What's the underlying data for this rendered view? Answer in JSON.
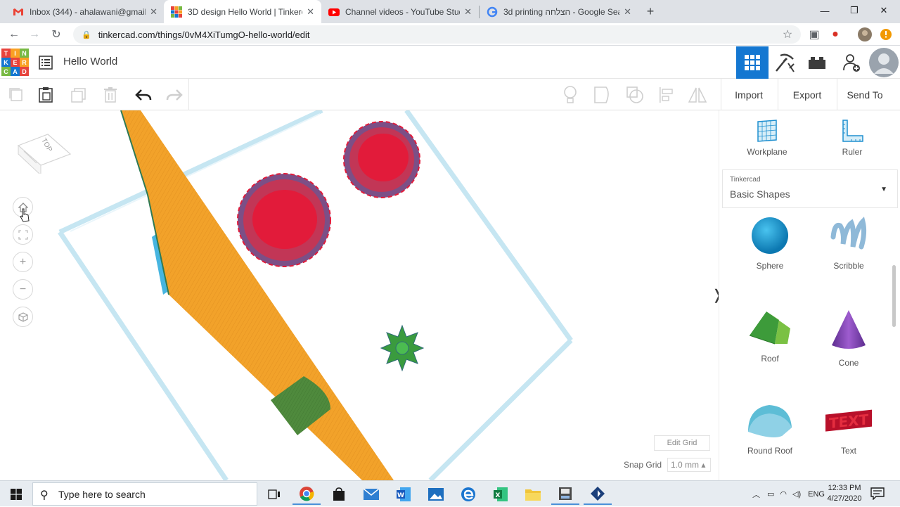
{
  "browser": {
    "tabs": [
      {
        "title": "Inbox (344) - ahalawani@gmail.c",
        "icon": "gmail-icon",
        "active": false
      },
      {
        "title": "3D design Hello World | Tinkerca",
        "icon": "tinkercad-icon",
        "active": true
      },
      {
        "title": "Channel videos - YouTube Studio",
        "icon": "youtube-icon",
        "active": false
      },
      {
        "title": "3d printing הצלחה - Google Sear",
        "icon": "google-icon",
        "active": false
      }
    ],
    "url": "tinkercad.com/things/0vM4XiTumgO-hello-world/edit"
  },
  "app": {
    "logo_letters": [
      "T",
      "I",
      "N",
      "K",
      "E",
      "R",
      "C",
      "A",
      "D"
    ],
    "design_title": "Hello World"
  },
  "toolbar": {
    "import_label": "Import",
    "export_label": "Export",
    "send_to_label": "Send To"
  },
  "canvas": {
    "view_cube_label": "TOP",
    "edit_grid_label": "Edit Grid",
    "snap_grid_label": "Snap Grid",
    "snap_grid_value": "1.0 mm ▴"
  },
  "panel": {
    "workplane_label": "Workplane",
    "ruler_label": "Ruler",
    "library_source": "Tinkercad",
    "library_name": "Basic Shapes",
    "shapes": [
      {
        "label": "Sphere",
        "icon": "sphere-icon"
      },
      {
        "label": "Scribble",
        "icon": "scribble-icon"
      },
      {
        "label": "Roof",
        "icon": "roof-icon"
      },
      {
        "label": "Cone",
        "icon": "cone-icon"
      },
      {
        "label": "Round Roof",
        "icon": "round-roof-icon"
      },
      {
        "label": "Text",
        "icon": "text-icon"
      }
    ]
  },
  "taskbar": {
    "search_placeholder": "Type here to search",
    "language": "ENG",
    "time": "12:33 PM",
    "date": "4/27/2020"
  },
  "colors": {
    "tinkercad_blue": "#1477d1",
    "orange_shape": "#f0a22a",
    "red_shape": "#e21b3a",
    "green_shape": "#3a9b3e",
    "workplane_border": "#c6e6f2"
  }
}
